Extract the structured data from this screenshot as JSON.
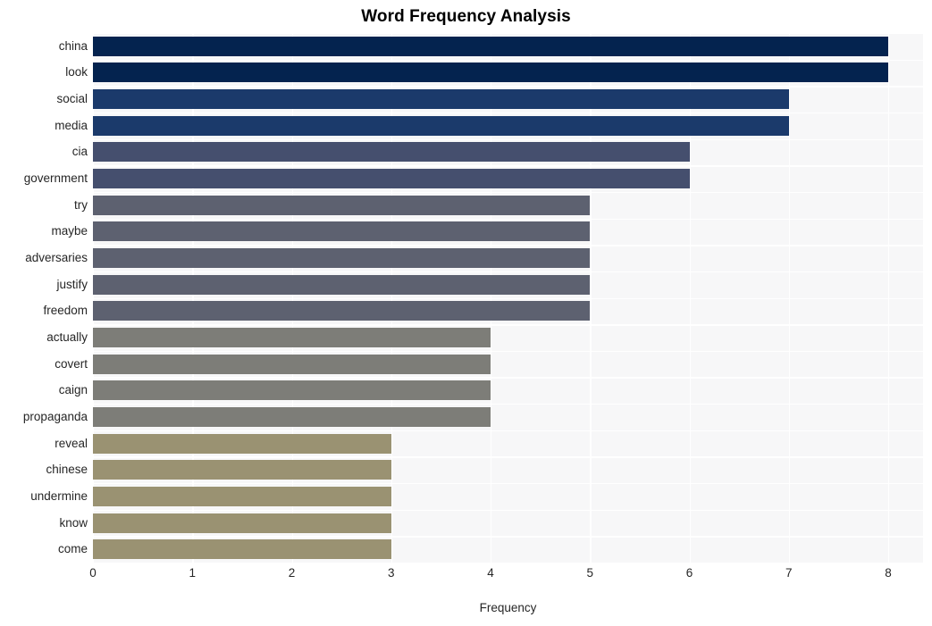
{
  "chart_data": {
    "type": "bar",
    "orientation": "horizontal",
    "title": "Word Frequency Analysis",
    "xlabel": "Frequency",
    "ylabel": "",
    "xlim": [
      0,
      8.35
    ],
    "xticks": [
      0,
      1,
      2,
      3,
      4,
      5,
      6,
      7,
      8
    ],
    "xtick_labels": [
      "0",
      "1",
      "2",
      "3",
      "4",
      "5",
      "6",
      "7",
      "8"
    ],
    "grid": true,
    "legend": "none",
    "categories": [
      "china",
      "look",
      "social",
      "media",
      "cia",
      "government",
      "try",
      "maybe",
      "adversaries",
      "justify",
      "freedom",
      "actually",
      "covert",
      "caign",
      "propaganda",
      "reveal",
      "chinese",
      "undermine",
      "know",
      "come"
    ],
    "values": [
      8,
      8,
      7,
      7,
      6,
      6,
      5,
      5,
      5,
      5,
      5,
      4,
      4,
      4,
      4,
      3,
      3,
      3,
      3,
      3
    ],
    "bar_colors": [
      "#04234f",
      "#04234f",
      "#1b3a6b",
      "#1b3a6b",
      "#454f6e",
      "#454f6e",
      "#5d6170",
      "#5d6170",
      "#5d6170",
      "#5d6170",
      "#5d6170",
      "#7d7d78",
      "#7d7d78",
      "#7d7d78",
      "#7d7d78",
      "#9a9272",
      "#9a9272",
      "#9a9272",
      "#9a9272",
      "#9a9272"
    ],
    "plot_background": "#f7f7f8",
    "gridline_color": "#ffffff",
    "figure_background": "#ffffff"
  }
}
